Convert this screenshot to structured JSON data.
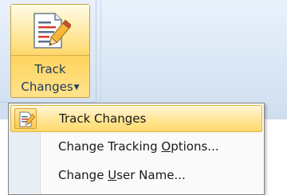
{
  "button": {
    "label_line1": "Track",
    "label_line2": "Changes",
    "icon": "track-changes-icon"
  },
  "menu": {
    "items": [
      {
        "before": "Track Chan",
        "underline": "g",
        "after": "es",
        "icon": "track-changes-icon",
        "highlighted": true
      },
      {
        "before": "Change Tracking ",
        "underline": "O",
        "after": "ptions...",
        "icon": null,
        "highlighted": false
      },
      {
        "before": "Change ",
        "underline": "U",
        "after": "ser Name...",
        "icon": null,
        "highlighted": false
      }
    ]
  },
  "colors": {
    "highlight": "#ffe79a",
    "highlight_border": "#e0b54c",
    "label_text": "#1e395b"
  }
}
